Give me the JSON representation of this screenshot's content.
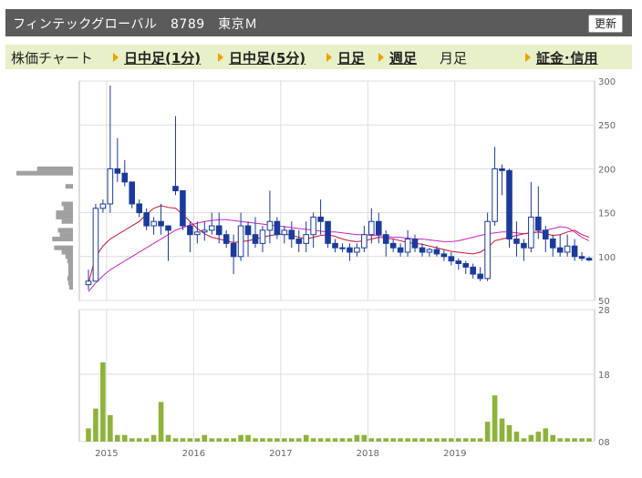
{
  "header": {
    "title": "フィンテックグローバル　8789　東京Ｍ",
    "refresh_label": "更新"
  },
  "nav": {
    "label": "株価チャート",
    "items": [
      {
        "label": "日中足(1分)",
        "link": true
      },
      {
        "label": "日中足(5分)",
        "link": true
      },
      {
        "label": "日足",
        "link": true
      },
      {
        "label": "週足",
        "link": true
      },
      {
        "label": "月足",
        "link": false
      },
      {
        "label": "証金･信用",
        "link": true
      }
    ]
  },
  "colors": {
    "candle_down": "#1a3a9c",
    "candle_up": "#ffffff",
    "ma_short": "#cc1133",
    "ma_long": "#cc22cc",
    "volume": "#8db33a",
    "volume_profile": "#a0a0a0",
    "grid": "#dddddd"
  },
  "chart_data": [
    {
      "type": "candlestick",
      "y_ticks": [
        "300",
        "250",
        "200",
        "150",
        "100",
        "50"
      ],
      "ylim": [
        50,
        300
      ],
      "x_ticks": [
        "2015",
        "2016",
        "2017",
        "2018",
        "2019"
      ],
      "x_tick_months": [
        3,
        15,
        27,
        39,
        51
      ],
      "candles": [
        [
          68,
          85,
          62,
          72
        ],
        [
          72,
          160,
          72,
          155
        ],
        [
          155,
          165,
          150,
          160
        ],
        [
          160,
          295,
          150,
          200
        ],
        [
          200,
          235,
          185,
          195
        ],
        [
          195,
          210,
          180,
          185
        ],
        [
          185,
          185,
          155,
          160
        ],
        [
          160,
          165,
          145,
          150
        ],
        [
          150,
          155,
          130,
          135
        ],
        [
          135,
          145,
          125,
          140
        ],
        [
          140,
          160,
          125,
          135
        ],
        [
          135,
          135,
          95,
          130
        ],
        [
          180,
          260,
          170,
          175
        ],
        [
          175,
          175,
          130,
          135
        ],
        [
          135,
          140,
          105,
          125
        ],
        [
          125,
          140,
          115,
          128
        ],
        [
          128,
          140,
          118,
          130
        ],
        [
          130,
          150,
          125,
          135
        ],
        [
          135,
          150,
          115,
          125
        ],
        [
          125,
          130,
          110,
          115
        ],
        [
          115,
          125,
          80,
          100
        ],
        [
          100,
          150,
          95,
          135
        ],
        [
          135,
          140,
          100,
          125
        ],
        [
          125,
          145,
          110,
          115
        ],
        [
          115,
          135,
          105,
          130
        ],
        [
          130,
          175,
          115,
          140
        ],
        [
          140,
          145,
          120,
          125
        ],
        [
          125,
          135,
          115,
          130
        ],
        [
          130,
          140,
          110,
          120
        ],
        [
          120,
          130,
          105,
          115
        ],
        [
          115,
          140,
          105,
          125
        ],
        [
          125,
          150,
          110,
          145
        ],
        [
          145,
          165,
          125,
          140
        ],
        [
          140,
          140,
          110,
          115
        ],
        [
          115,
          120,
          105,
          110
        ],
        [
          110,
          115,
          105,
          110
        ],
        [
          110,
          115,
          95,
          105
        ],
        [
          105,
          115,
          100,
          110
        ],
        [
          110,
          135,
          105,
          125
        ],
        [
          125,
          155,
          115,
          140
        ],
        [
          140,
          150,
          115,
          125
        ],
        [
          125,
          130,
          100,
          115
        ],
        [
          115,
          120,
          105,
          110
        ],
        [
          110,
          115,
          100,
          105
        ],
        [
          105,
          130,
          100,
          120
        ],
        [
          120,
          125,
          105,
          110
        ],
        [
          110,
          115,
          100,
          105
        ],
        [
          105,
          110,
          100,
          108
        ],
        [
          108,
          112,
          100,
          103
        ],
        [
          103,
          108,
          95,
          100
        ],
        [
          100,
          105,
          90,
          95
        ],
        [
          95,
          98,
          85,
          92
        ],
        [
          92,
          95,
          80,
          88
        ],
        [
          88,
          92,
          75,
          80
        ],
        [
          80,
          88,
          72,
          75
        ],
        [
          75,
          150,
          72,
          140
        ],
        [
          140,
          225,
          135,
          200
        ],
        [
          200,
          205,
          170,
          198
        ],
        [
          198,
          200,
          110,
          120
        ],
        [
          120,
          140,
          100,
          115
        ],
        [
          115,
          120,
          95,
          110
        ],
        [
          110,
          185,
          105,
          145
        ],
        [
          145,
          180,
          120,
          130
        ],
        [
          130,
          135,
          105,
          120
        ],
        [
          120,
          125,
          100,
          110
        ],
        [
          110,
          125,
          100,
          105
        ],
        [
          105,
          125,
          100,
          112
        ],
        [
          112,
          120,
          95,
          100
        ],
        [
          100,
          105,
          95,
          98
        ],
        [
          98,
          100,
          95,
          96
        ]
      ],
      "ma_short": [
        70,
        100,
        112,
        120,
        125,
        130,
        135,
        140,
        148,
        155,
        158,
        156,
        155,
        148,
        140,
        132,
        126,
        122,
        120,
        118,
        116,
        117,
        118,
        120,
        122,
        124,
        125,
        126,
        124,
        122,
        120,
        122,
        124,
        125,
        123,
        120,
        118,
        117,
        118,
        120,
        122,
        121,
        120,
        118,
        116,
        115,
        114,
        112,
        110,
        108,
        106,
        105,
        104,
        103,
        105,
        110,
        118,
        120,
        122,
        124,
        126,
        127,
        128,
        126,
        124,
        125,
        128,
        130,
        125,
        122
      ],
      "ma_long": [
        60,
        70,
        78,
        85,
        90,
        95,
        100,
        105,
        110,
        115,
        120,
        125,
        130,
        133,
        136,
        138,
        140,
        141,
        142,
        142,
        141,
        140,
        139,
        138,
        137,
        136,
        135,
        134,
        133,
        132,
        131,
        130,
        129,
        128,
        128,
        127,
        126,
        125,
        125,
        124,
        124,
        123,
        122,
        122,
        121,
        120,
        120,
        119,
        118,
        117,
        117,
        118,
        120,
        122,
        124,
        126,
        127,
        128,
        128,
        127,
        126,
        127,
        128,
        130,
        132,
        134,
        133,
        128,
        122,
        118
      ]
    },
    {
      "type": "bar",
      "y_ticks": [
        "28",
        "18",
        "08"
      ],
      "volumes": [
        2,
        5,
        12,
        4,
        1,
        1,
        0.5,
        0.5,
        0.5,
        1,
        6,
        1,
        0.5,
        0.5,
        0.5,
        0.5,
        1,
        0.5,
        0.5,
        0.5,
        0.5,
        1,
        1,
        0.5,
        0.5,
        0.5,
        0.5,
        0.5,
        0.5,
        0.5,
        1,
        0.5,
        0.5,
        0.5,
        0.5,
        0.5,
        0.5,
        1,
        1,
        0.5,
        0.5,
        0.5,
        0.5,
        0.5,
        0.5,
        0.5,
        0.5,
        0.5,
        0.5,
        0.5,
        0.5,
        0.5,
        0.5,
        0.5,
        0.5,
        3,
        7,
        3.5,
        2.5,
        1.5,
        0.5,
        1,
        1.5,
        2,
        1,
        0.5,
        0.5,
        0.5,
        0.5,
        0.5
      ],
      "vmax": 20
    },
    {
      "type": "bar",
      "orientation": "horizontal",
      "price_levels": [
        200,
        195,
        180,
        160,
        155,
        150,
        145,
        140,
        130,
        125,
        120,
        110,
        105,
        100,
        95,
        90,
        85,
        80,
        75,
        70,
        65
      ],
      "volumes": [
        38,
        60,
        8,
        12,
        10,
        18,
        18,
        12,
        16,
        14,
        22,
        20,
        12,
        8,
        6,
        5,
        5,
        5,
        6,
        5,
        4
      ]
    }
  ]
}
